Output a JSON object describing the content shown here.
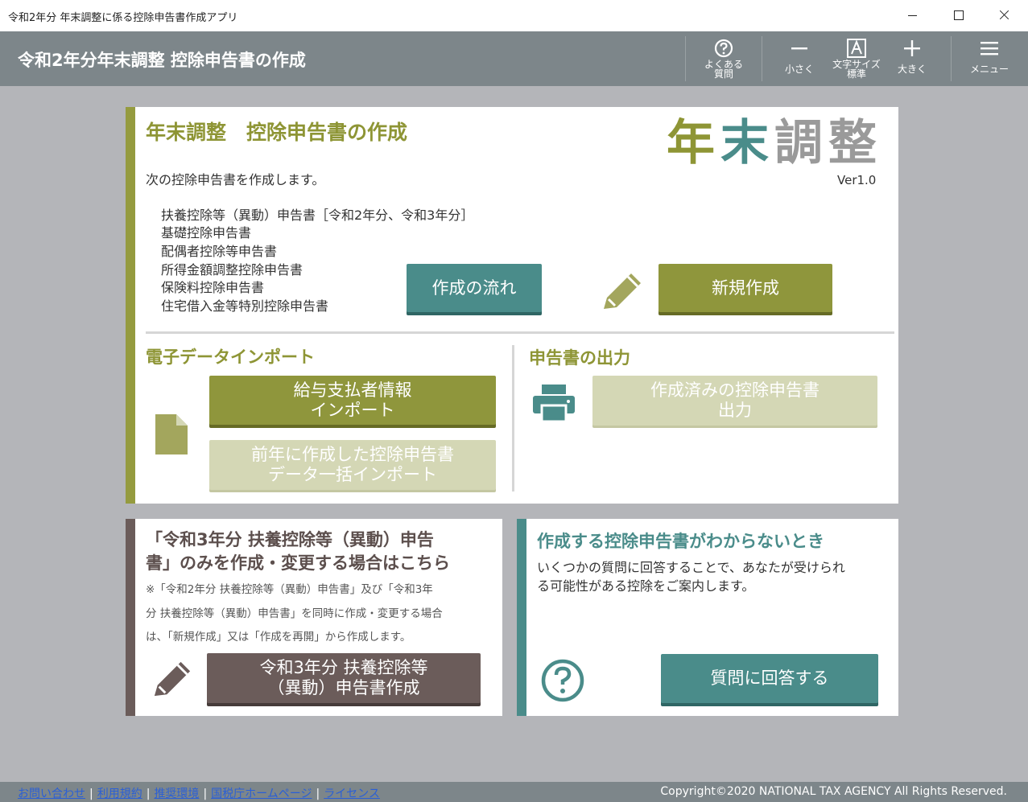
{
  "window": {
    "title": "令和2年分 年末調整に係る控除申告書作成アプリ"
  },
  "header": {
    "title": "令和2年分年末調整 控除申告書の作成",
    "faq": [
      "よくある",
      "質問"
    ],
    "smaller": "小さく",
    "font_standard": [
      "文字サイズ",
      "標準"
    ],
    "larger": "大きく",
    "menu": "メニュー"
  },
  "main": {
    "title": "年末調整　控除申告書の作成",
    "logo": "年末調整",
    "version": "Ver1.0",
    "intro": "次の控除申告書を作成します。",
    "forms": [
      "扶養控除等（異動）申告書［令和2年分、令和3年分］",
      "基礎控除申告書",
      "配偶者控除等申告書",
      "所得金額調整控除申告書",
      "保険料控除申告書",
      "住宅借入金等特別控除申告書"
    ],
    "flow_button": "作成の流れ",
    "new_button": "新規作成",
    "import_heading": "電子データインポート",
    "import_payer": [
      "給与支払者情報",
      "インポート"
    ],
    "import_prev": [
      "前年に作成した控除申告書",
      "データ一括インポート"
    ],
    "output_heading": "申告書の出力",
    "output_button": [
      "作成済みの控除申告書",
      "出力"
    ]
  },
  "reiwa3": {
    "heading": [
      "「令和3年分 扶養控除等（異動）申告",
      "書」のみを作成・変更する場合はこちら"
    ],
    "note": [
      "※「令和2年分 扶養控除等（異動）申告書」及び「令和3年",
      "分 扶養控除等（異動）申告書」を同時に作成・変更する場合",
      "は、「新規作成」又は「作成を再開」から作成します。"
    ],
    "button": [
      "令和3年分 扶養控除等",
      "（異動）申告書作成"
    ]
  },
  "help": {
    "heading": "作成する控除申告書がわからないとき",
    "body": [
      "いくつかの質問に回答することで、あなたが受けられ",
      "る可能性がある控除をご案内します。"
    ],
    "button": "質問に回答する"
  },
  "footer": {
    "links": [
      "お問い合わせ",
      "利用規約",
      "推奨環境",
      "国税庁ホームページ",
      "ライセンス"
    ],
    "copyright": "Copyright©2020 NATIONAL TAX AGENCY All Rights Reserved."
  },
  "colors": {
    "olive": "#8f963c",
    "teal": "#4a8c8a",
    "brown": "#6b5c5a",
    "header": "#7d868a"
  }
}
